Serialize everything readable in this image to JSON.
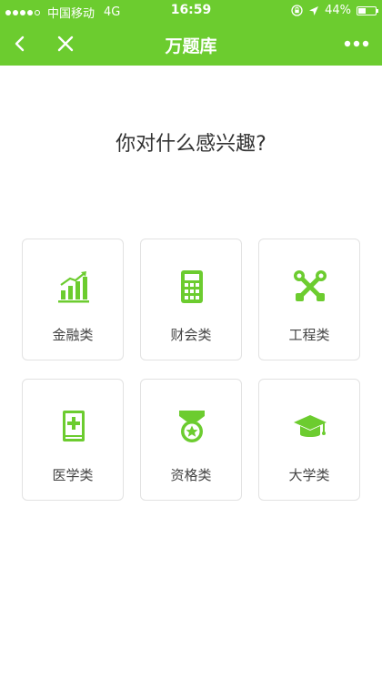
{
  "status_bar": {
    "carrier": "中国移动",
    "network": "4G",
    "time": "16:59",
    "battery": "44%",
    "signal_filled_dots": 1,
    "signal_total_dots": 5,
    "battery_level": 0.44
  },
  "nav": {
    "title": "万题库",
    "back_icon": "chevron-left-icon",
    "close_icon": "close-icon",
    "more_icon": "more-horizontal-icon"
  },
  "question": "你对什么感兴趣?",
  "categories": [
    {
      "label": "金融类",
      "icon": "bar-chart-icon"
    },
    {
      "label": "财会类",
      "icon": "calculator-icon"
    },
    {
      "label": "工程类",
      "icon": "tools-icon"
    },
    {
      "label": "医学类",
      "icon": "medical-book-icon"
    },
    {
      "label": "资格类",
      "icon": "medal-icon"
    },
    {
      "label": "大学类",
      "icon": "graduation-cap-icon"
    }
  ],
  "colors": {
    "brand_green": "#6ccc2f",
    "text_dark": "#333333",
    "card_border": "#e2e2e2"
  }
}
